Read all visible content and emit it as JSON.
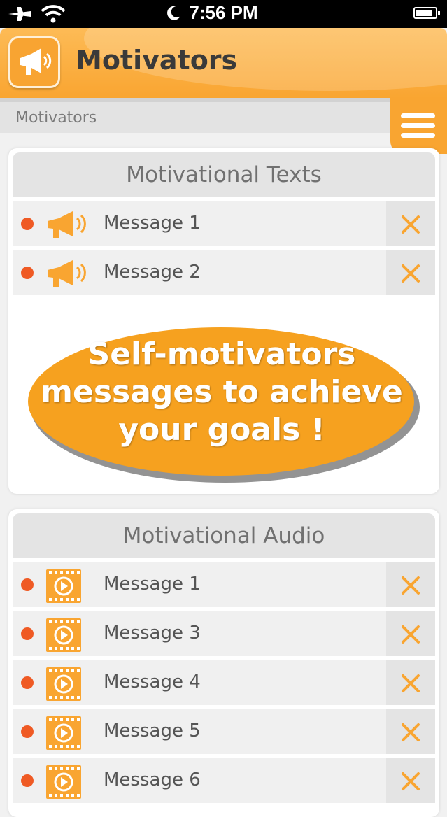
{
  "status_bar": {
    "time": "7:56 PM"
  },
  "header": {
    "title": "Motivators",
    "icon": "megaphone-icon"
  },
  "breadcrumb": "Motivators",
  "sections": {
    "texts": {
      "title": "Motivational Texts",
      "items": [
        {
          "label": "Message 1",
          "icon": "megaphone-icon"
        },
        {
          "label": "Message 2",
          "icon": "megaphone-icon"
        }
      ],
      "banner": {
        "line1": "Self-motivators",
        "line2": "messages to achieve",
        "line3": "your goals !"
      }
    },
    "audio": {
      "title": "Motivational Audio",
      "items": [
        {
          "label": "Message 1",
          "icon": "video-play-icon"
        },
        {
          "label": "Message 3",
          "icon": "video-play-icon"
        },
        {
          "label": "Message 4",
          "icon": "video-play-icon"
        },
        {
          "label": "Message 5",
          "icon": "video-play-icon"
        },
        {
          "label": "Message 6",
          "icon": "video-play-icon"
        }
      ]
    }
  },
  "colors": {
    "accent": "#f9a531",
    "dot": "#ef5a24",
    "delete": "#f9a531"
  }
}
